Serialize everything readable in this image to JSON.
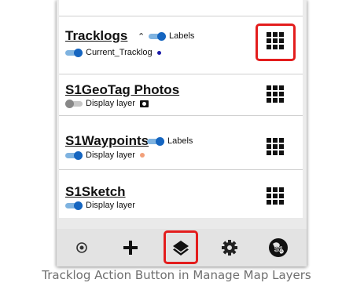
{
  "layers": [
    {
      "title": "Tracklogs",
      "labels_text": "Labels",
      "labels_on": true,
      "sub_label": "Current_Tracklog",
      "sub_on": true,
      "sub_marker": "dot-blue"
    },
    {
      "title": "S1GeoTag Photos",
      "sub_label": "Display layer",
      "sub_on": false,
      "sub_marker": "camera-icon"
    },
    {
      "title": "S1Waypoints",
      "labels_text": "Labels",
      "labels_on": true,
      "sub_label": "Display layer",
      "sub_on": true,
      "sub_marker": "dot-orange"
    },
    {
      "title": "S1Sketch",
      "sub_label": "Display layer",
      "sub_on": true
    }
  ],
  "bottom_nav": [
    "target-icon",
    "plus-icon",
    "layers-icon",
    "gear-icon",
    "s1-globe-icon"
  ],
  "active_nav": "layers-icon",
  "caption": "Tracklog Action Button in Manage Map Layers",
  "colors": {
    "highlight": "#e31d1d",
    "toggle_on": "#1565c0",
    "dot_blue": "#1a1aa8",
    "dot_orange": "#f2a07a"
  }
}
